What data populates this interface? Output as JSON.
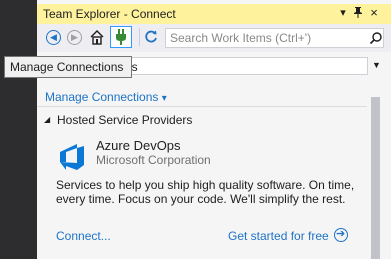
{
  "window": {
    "title": "Team Explorer - Connect",
    "pin_glyph": "▾",
    "autohide_glyph": "📌",
    "close_glyph": "×"
  },
  "toolbar": {
    "back_glyph": "◀",
    "forward_glyph": "▶",
    "search_placeholder": "Search Work Items (Ctrl+')"
  },
  "project_dropdown": {
    "value_fragment": "ps"
  },
  "tooltip": {
    "text": "Manage Connections"
  },
  "manage_link": {
    "label": "Manage Connections",
    "chevron": "▾"
  },
  "section": {
    "arrow": "◢",
    "title": "Hosted Service Providers"
  },
  "provider": {
    "name": "Azure DevOps",
    "company": "Microsoft Corporation",
    "description": "Services to help you ship high quality software. On time, every time. Focus on your code. We'll simplify the rest.",
    "connect_label": "Connect...",
    "get_started_label": "Get started for free"
  },
  "colors": {
    "title_bar": "#fff29d",
    "link": "#1e73c6",
    "azure": "#0a78d4"
  }
}
